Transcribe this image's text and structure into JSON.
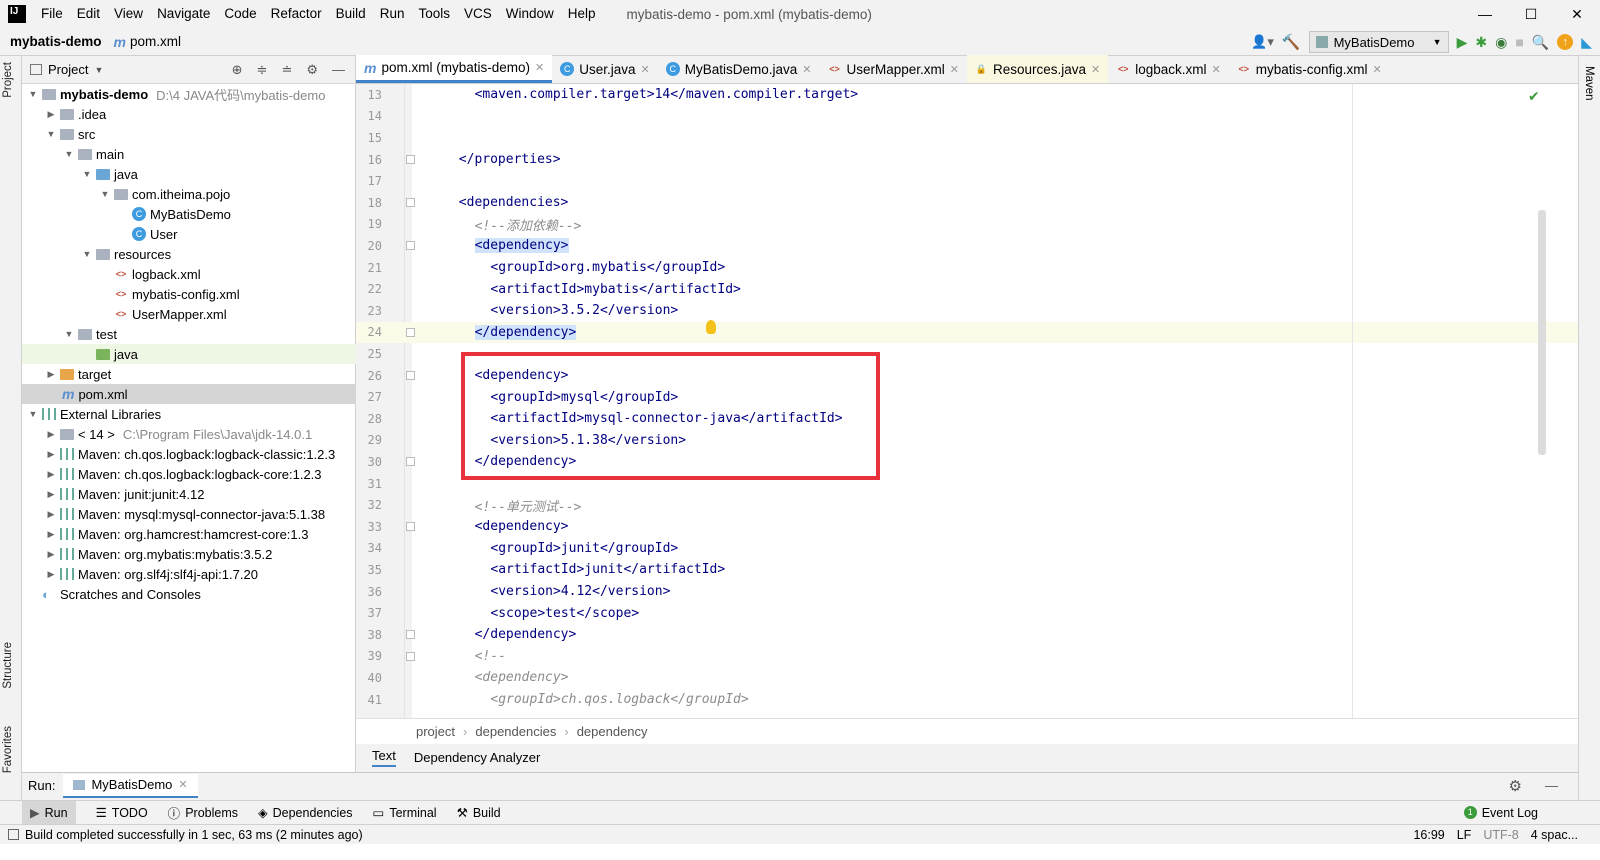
{
  "app": {
    "logo": "IJ",
    "menu": [
      "File",
      "Edit",
      "View",
      "Navigate",
      "Code",
      "Refactor",
      "Build",
      "Run",
      "Tools",
      "VCS",
      "Window",
      "Help"
    ],
    "window_title": "mybatis-demo - pom.xml (mybatis-demo)",
    "win_min": "—",
    "win_max": "☐",
    "win_close": "✕"
  },
  "navbar": {
    "project": "mybatis-demo",
    "file": "pom.xml",
    "run_config": "MyBatisDemo"
  },
  "left_strip": {
    "project": "Project",
    "structure": "Structure",
    "favorites": "Favorites"
  },
  "right_strip": {
    "maven": "Maven"
  },
  "project_panel": {
    "title": "Project",
    "tree": [
      {
        "label": "mybatis-demo",
        "extra": "D:\\4 JAVA代码\\mybatis-demo",
        "bold": true
      },
      {
        "label": ".idea"
      },
      {
        "label": "src"
      },
      {
        "label": "main"
      },
      {
        "label": "java"
      },
      {
        "label": "com.itheima.pojo"
      },
      {
        "label": "MyBatisDemo"
      },
      {
        "label": "User"
      },
      {
        "label": "resources"
      },
      {
        "label": "logback.xml"
      },
      {
        "label": "mybatis-config.xml"
      },
      {
        "label": "UserMapper.xml"
      },
      {
        "label": "test"
      },
      {
        "label": "java"
      },
      {
        "label": "target"
      },
      {
        "label": "pom.xml"
      },
      {
        "label": "External Libraries"
      },
      {
        "label": "< 14 >",
        "extra": "C:\\Program Files\\Java\\jdk-14.0.1"
      },
      {
        "label": "Maven: ch.qos.logback:logback-classic:1.2.3"
      },
      {
        "label": "Maven: ch.qos.logback:logback-core:1.2.3"
      },
      {
        "label": "Maven: junit:junit:4.12"
      },
      {
        "label": "Maven: mysql:mysql-connector-java:5.1.38"
      },
      {
        "label": "Maven: org.hamcrest:hamcrest-core:1.3"
      },
      {
        "label": "Maven: org.mybatis:mybatis:3.5.2"
      },
      {
        "label": "Maven: org.slf4j:slf4j-api:1.7.20"
      },
      {
        "label": "Scratches and Consoles"
      }
    ]
  },
  "editor_tabs": [
    {
      "label": "pom.xml (mybatis-demo)",
      "active": true
    },
    {
      "label": "User.java"
    },
    {
      "label": "MyBatisDemo.java"
    },
    {
      "label": "UserMapper.xml"
    },
    {
      "label": "Resources.java"
    },
    {
      "label": "logback.xml"
    },
    {
      "label": "mybatis-config.xml"
    }
  ],
  "code_lines": [
    {
      "n": "13",
      "text": "<maven.compiler.target>14</maven.compiler.target>"
    },
    {
      "n": "14",
      "text": ""
    },
    {
      "n": "15",
      "text": ""
    },
    {
      "n": "16",
      "text": "</properties>"
    },
    {
      "n": "17",
      "text": ""
    },
    {
      "n": "18",
      "text": "<dependencies>"
    },
    {
      "n": "19",
      "text": "<!--添加依赖-->"
    },
    {
      "n": "20",
      "text": "<dependency>"
    },
    {
      "n": "21",
      "text": "<groupId>org.mybatis</groupId>"
    },
    {
      "n": "22",
      "text": "<artifactId>mybatis</artifactId>"
    },
    {
      "n": "23",
      "text": "<version>3.5.2</version>"
    },
    {
      "n": "24",
      "text": "</dependency>"
    },
    {
      "n": "25",
      "text": ""
    },
    {
      "n": "26",
      "text": "<dependency>"
    },
    {
      "n": "27",
      "text": "<groupId>mysql</groupId>"
    },
    {
      "n": "28",
      "text": "<artifactId>mysql-connector-java</artifactId>"
    },
    {
      "n": "29",
      "text": "<version>5.1.38</version>"
    },
    {
      "n": "30",
      "text": "</dependency>"
    },
    {
      "n": "31",
      "text": ""
    },
    {
      "n": "32",
      "text": "<!--单元测试-->"
    },
    {
      "n": "33",
      "text": "<dependency>"
    },
    {
      "n": "34",
      "text": "<groupId>junit</groupId>"
    },
    {
      "n": "35",
      "text": "<artifactId>junit</artifactId>"
    },
    {
      "n": "36",
      "text": "<version>4.12</version>"
    },
    {
      "n": "37",
      "text": "<scope>test</scope>"
    },
    {
      "n": "38",
      "text": "</dependency>"
    },
    {
      "n": "39",
      "text": "<!--"
    },
    {
      "n": "40",
      "text": "<dependency>"
    },
    {
      "n": "41",
      "text": "<groupId>ch.qos.logback</groupId>"
    }
  ],
  "breadcrumb": [
    "project",
    "dependencies",
    "dependency"
  ],
  "bottom_editor_tabs": {
    "text": "Text",
    "analyzer": "Dependency Analyzer"
  },
  "run_bar": {
    "label": "Run:",
    "config": "MyBatisDemo"
  },
  "tool_windows": {
    "run": "Run",
    "todo": "TODO",
    "problems": "Problems",
    "dependencies": "Dependencies",
    "terminal": "Terminal",
    "build": "Build",
    "event_log": "Event Log"
  },
  "status": {
    "message": "Build completed successfully in 1 sec, 63 ms (2 minutes ago)",
    "position": "16:99",
    "line_sep": "LF",
    "encoding": "UTF-8",
    "indent": "4 spac..."
  }
}
